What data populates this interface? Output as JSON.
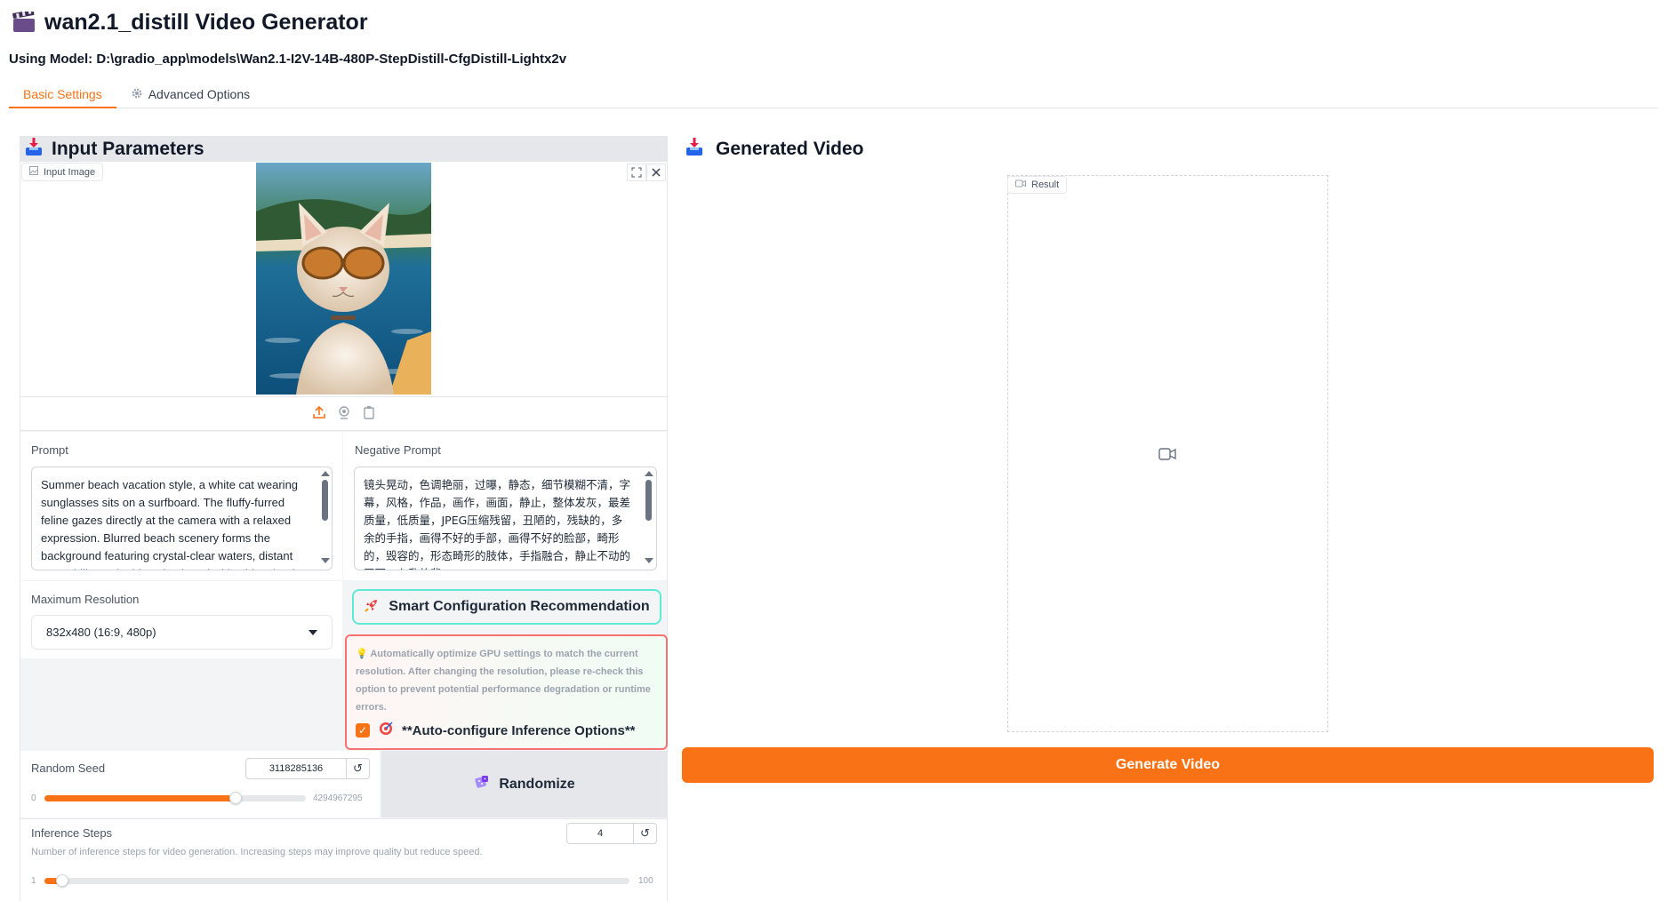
{
  "app": {
    "title": "wan2.1_distill Video Generator",
    "model_line": "Using Model: D:\\gradio_app\\models\\Wan2.1-I2V-14B-480P-StepDistill-CfgDistill-Lightx2v"
  },
  "tabs": [
    {
      "label": "Basic Settings",
      "active": true
    },
    {
      "label": "Advanced Options",
      "active": false,
      "icon": "gear-icon"
    }
  ],
  "input_panel": {
    "title": "Input Parameters",
    "image_label": "Input Image",
    "prompt_label": "Prompt",
    "prompt_value": "Summer beach vacation style, a white cat wearing sunglasses sits on a surfboard. The fluffy-furred feline gazes directly at the camera with a relaxed expression. Blurred beach scenery forms the background featuring crystal-clear waters, distant green hills, and a blue sky dotted with white clouds",
    "negative_label": "Negative Prompt",
    "negative_value": "镜头晃动，色调艳丽，过曝，静态，细节模糊不清，字幕，风格，作品，画作，画面，静止，整体发灰，最差质量，低质量，JPEG压缩残留，丑陋的，残缺的，多余的手指，画得不好的手部，画得不好的脸部，畸形的，毁容的，形态畸形的肢体，手指融合，静止不动的画面，杂乱的背",
    "resolution_label": "Maximum Resolution",
    "resolution_value": "832x480 (16:9, 480p)",
    "smart_button": "Smart Configuration Recommendation",
    "auto_note": "Automatically optimize GPU settings to match the current resolution. After changing the resolution, please re-check this option to prevent potential performance degradation or runtime errors.",
    "auto_check_label": "**Auto-configure Inference Options**",
    "auto_checked": true,
    "seed_label": "Random Seed",
    "seed_value": "3118285136",
    "seed_min": "0",
    "seed_max": "4294967295",
    "seed_fraction": 0.73,
    "randomize_label": "Randomize",
    "steps_label": "Inference Steps",
    "steps_info": "Number of inference steps for video generation. Increasing steps may improve quality but reduce speed.",
    "steps_value": "4",
    "steps_min": "1",
    "steps_max": "100",
    "steps_fraction": 0.03
  },
  "output_panel": {
    "title": "Generated Video",
    "result_label": "Result",
    "generate_button": "Generate Video"
  },
  "colors": {
    "accent": "#f97316",
    "teal_border": "#5eead4",
    "red_border": "#f87171"
  }
}
